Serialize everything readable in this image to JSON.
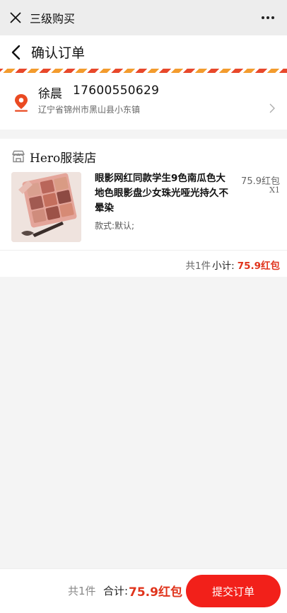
{
  "topbar": {
    "title": "三级购买"
  },
  "header": {
    "title": "确认订单"
  },
  "address": {
    "name": "徐晨",
    "phone": "17600550629",
    "detail": "辽宁省锦州市黑山县小东镇"
  },
  "shop": {
    "name": "Hero服装店",
    "product": {
      "title": "眼影网红同款学生9色南瓜色大地色眼影盘少女珠光哑光持久不晕染",
      "spec": "款式:默认;",
      "price": "75.9红包",
      "qty": "X1"
    },
    "subtotal": {
      "count": "共1件",
      "label": "小计:",
      "amount": "75.9红包"
    }
  },
  "bottom": {
    "count": "共1件",
    "total_label": "合计:",
    "total_amount": "75.9红包",
    "submit_label": "提交订单"
  },
  "colors": {
    "accent": "#f2201a",
    "price": "#e0341c"
  },
  "icons": {
    "close": "close-icon",
    "more": "more-icon",
    "back": "back-icon",
    "location": "location-pin-icon",
    "chevron": "chevron-right-icon",
    "shop": "shop-icon"
  }
}
